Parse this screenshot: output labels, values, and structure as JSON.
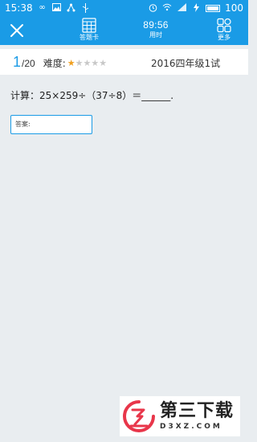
{
  "status_bar": {
    "time": "15:38",
    "battery": "100"
  },
  "toolbar": {
    "answer_sheet_label": "答题卡",
    "timer_value": "89:56",
    "timer_label": "用时",
    "more_label": "更多"
  },
  "question_info": {
    "current": "1",
    "total": "/20",
    "difficulty_label": "难度:",
    "difficulty_rating": 1,
    "difficulty_max": 5,
    "exam_title": "2016四年级1试"
  },
  "question": {
    "text": "计算：25×259÷（37÷8）＝______."
  },
  "answer": {
    "placeholder": "答案:"
  },
  "watermark": {
    "name": "第三下载",
    "url": "D3XZ.COM"
  },
  "colors": {
    "primary": "#1a9be6",
    "background": "#e9edf0",
    "star_filled": "#f0a020",
    "star_empty": "#c8c8c8",
    "watermark_accent": "#e8364a"
  }
}
